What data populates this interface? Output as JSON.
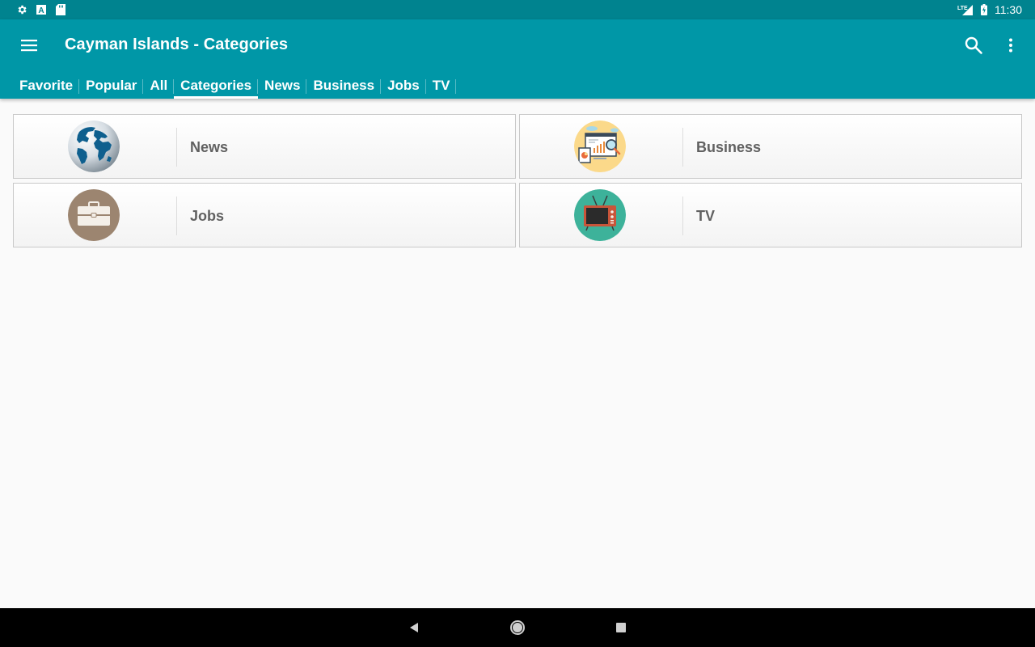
{
  "status_bar": {
    "time": "11:30",
    "left_icons": [
      "settings-icon",
      "a-box-icon",
      "sd-card-icon"
    ],
    "right_icons": [
      "lte-signal-icon",
      "battery-icon"
    ],
    "lte_label": "LTE"
  },
  "app_bar": {
    "title": "Cayman Islands - Categories",
    "color": "#0097a7",
    "status_color": "#00838f"
  },
  "tabs": [
    {
      "label": "Favorite"
    },
    {
      "label": "Popular"
    },
    {
      "label": "All"
    },
    {
      "label": "Categories",
      "active": true
    },
    {
      "label": "News"
    },
    {
      "label": "Business"
    },
    {
      "label": "Jobs"
    },
    {
      "label": "TV"
    }
  ],
  "categories": [
    {
      "label": "News",
      "icon": "globe-icon"
    },
    {
      "label": "Business",
      "icon": "business-analytics-icon"
    },
    {
      "label": "Jobs",
      "icon": "briefcase-icon"
    },
    {
      "label": "TV",
      "icon": "television-icon"
    }
  ],
  "nav_bar": {
    "buttons": [
      "back-icon",
      "home-icon",
      "recents-icon"
    ]
  }
}
